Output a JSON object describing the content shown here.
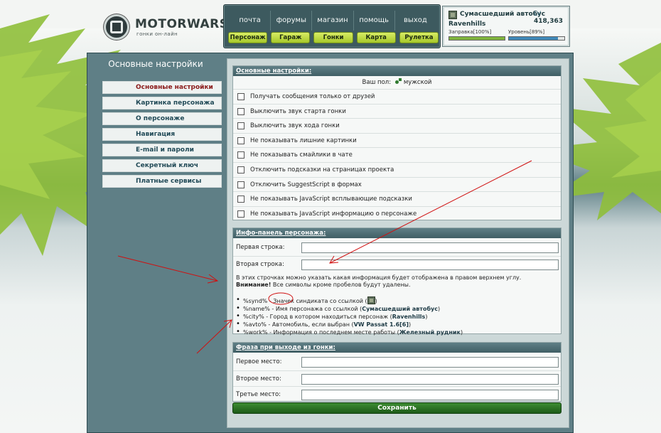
{
  "logo": {
    "name": "MOTORWARS.RU",
    "tagline": "гонки он-лайн"
  },
  "nav": {
    "top": [
      "почта",
      "форумы",
      "магазин",
      "помощь",
      "выход"
    ],
    "bottom": [
      "Персонаж",
      "Гараж",
      "Гонки",
      "Карта",
      "Рулетка"
    ]
  },
  "profile": {
    "name": "Сумасшедший автобус",
    "level_label": "LV",
    "level_value": "418,363",
    "city": "Ravenhills",
    "fuel_label": "Заправка[100%]",
    "fuel": 1.0,
    "level_progress_label": "Уровень[89%]",
    "level_progress": 0.89
  },
  "page": {
    "section_title": "Основные настройки"
  },
  "sidebar": {
    "items": [
      {
        "label": "Основные настройки",
        "active": true
      },
      {
        "label": "Картинка персонажа"
      },
      {
        "label": "О персонаже"
      },
      {
        "label": "Навигация"
      },
      {
        "label": "E-mail и пароли"
      },
      {
        "label": "Секретный ключ"
      },
      {
        "label": "Платные сервисы"
      }
    ]
  },
  "settings": {
    "header": "Основные настройки:",
    "gender_label": "Ваш пол:",
    "gender_value": "мужской",
    "checkboxes": [
      "Получать сообщения только от друзей",
      "Выключить звук старта гонки",
      "Выключить звук хода гонки",
      "Не показывать лишние картинки",
      "Не показывать смайлики в чате",
      "Отключить подсказки на страницах проекта",
      "Отключить SuggestScript в формах",
      "Не показывать JavaScript всплывающие подсказки",
      "Не показывать JavaScript информацию о персонаже"
    ]
  },
  "infopanel": {
    "header": "Инфо-панель персонажа:",
    "line1_label": "Первая строка:",
    "line1_value": "",
    "line2_label": "Вторая строка:",
    "line2_value": "",
    "description": "В этих строчках можно указать какая информация будет отображена в правом верхнем углу.",
    "warning_strong": "Внимание!",
    "warning_text": " Все символы кроме пробелов будут удалены.",
    "vars": [
      {
        "code": "%synd%",
        "text": " - Значек синдиката со ссылкой (",
        "value": "",
        "after": ")"
      },
      {
        "code": "%name%",
        "text": " - Имя персонажа со ссылкой (",
        "value": "Сумасшедший автобус",
        "after": ")"
      },
      {
        "code": "%city%",
        "text": " - Город в котором находиться персонаж (",
        "value": "Ravenhills",
        "after": ")"
      },
      {
        "code": "%avto%",
        "text": " - Автомобиль, если выбран (",
        "value": "VW Passat 1.6[6]",
        "after": ")"
      },
      {
        "code": "%work%",
        "text": " - Информация о последнем месте работы (",
        "value": "Железный рудник",
        "after": ")"
      }
    ]
  },
  "exit_phrase": {
    "header": "Фраза при выходе из гонки:",
    "first_label": "Первое место:",
    "first_value": "",
    "second_label": "Второе место:",
    "second_value": "",
    "third_label": "Третье место:",
    "third_value": ""
  },
  "save_label": "Сохранить",
  "colors": {
    "accent_green": "#2f7a2f",
    "header_teal": "#5f7f86",
    "annotation_red": "#d01010"
  }
}
